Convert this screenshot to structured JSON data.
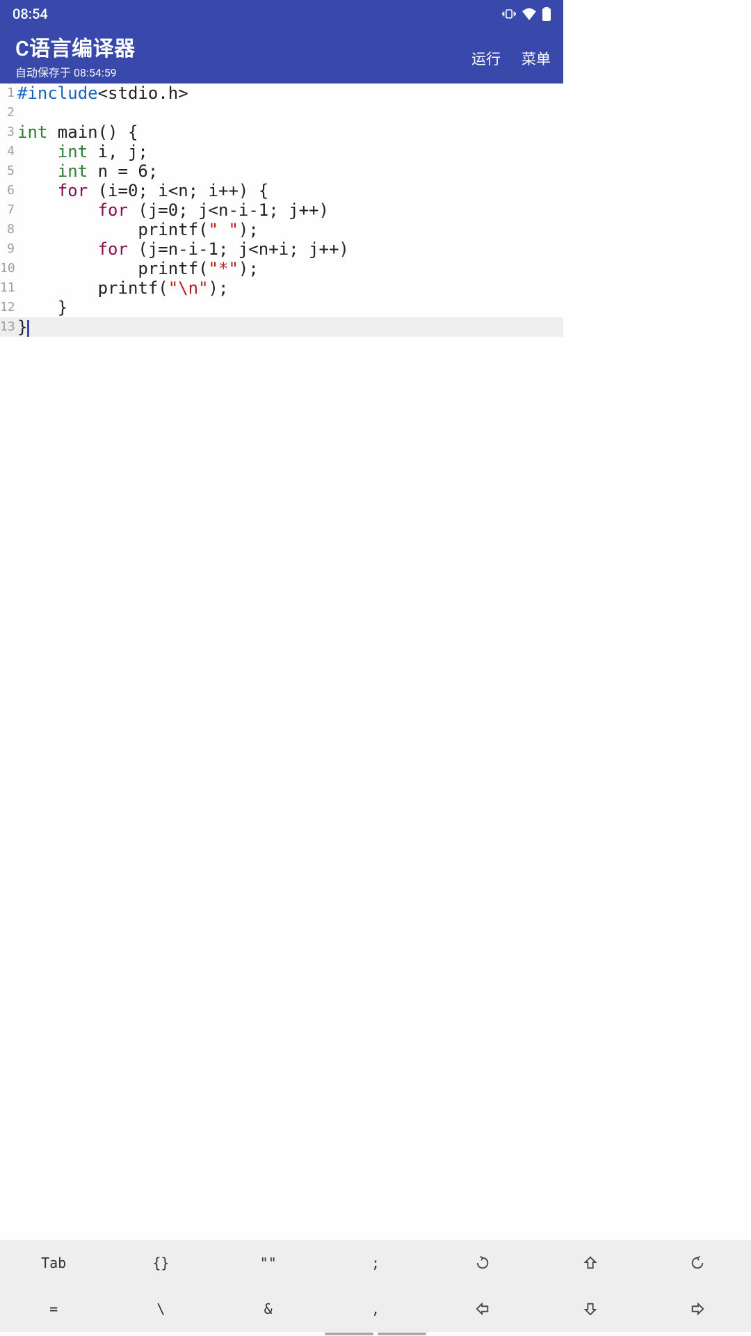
{
  "status": {
    "time": "08:54"
  },
  "app": {
    "title": "C语言编译器",
    "subtitle": "自动保存于 08:54:59",
    "actions": {
      "run": "运行",
      "menu": "菜单"
    }
  },
  "editor": {
    "current_line": 13,
    "lines": [
      {
        "n": "1",
        "tokens": [
          [
            "#include",
            "prep"
          ],
          [
            "<stdio.h>",
            "punct"
          ]
        ]
      },
      {
        "n": "2",
        "tokens": []
      },
      {
        "n": "3",
        "tokens": [
          [
            "int ",
            "kw"
          ],
          [
            "main",
            "fn"
          ],
          [
            "() {",
            "punct"
          ]
        ]
      },
      {
        "n": "4",
        "tokens": [
          [
            "    ",
            "punct"
          ],
          [
            "int ",
            "kw"
          ],
          [
            "i, j;",
            "ident"
          ]
        ]
      },
      {
        "n": "5",
        "tokens": [
          [
            "    ",
            "punct"
          ],
          [
            "int ",
            "kw"
          ],
          [
            "n = ",
            "ident"
          ],
          [
            "6",
            "num"
          ],
          [
            ";",
            "punct"
          ]
        ]
      },
      {
        "n": "6",
        "tokens": [
          [
            "    ",
            "punct"
          ],
          [
            "for ",
            "ctrl"
          ],
          [
            "(i=",
            "ident"
          ],
          [
            "0",
            "num"
          ],
          [
            "; i<n; i++) {",
            "ident"
          ]
        ]
      },
      {
        "n": "7",
        "tokens": [
          [
            "        ",
            "punct"
          ],
          [
            "for ",
            "ctrl"
          ],
          [
            "(j=",
            "ident"
          ],
          [
            "0",
            "num"
          ],
          [
            "; j<n-i-",
            "ident"
          ],
          [
            "1",
            "num"
          ],
          [
            "; j++)",
            "ident"
          ]
        ]
      },
      {
        "n": "8",
        "tokens": [
          [
            "            printf(",
            "fn"
          ],
          [
            "\" \"",
            "str"
          ],
          [
            ");",
            "punct"
          ]
        ]
      },
      {
        "n": "9",
        "tokens": [
          [
            "        ",
            "punct"
          ],
          [
            "for ",
            "ctrl"
          ],
          [
            "(j=n-i-",
            "ident"
          ],
          [
            "1",
            "num"
          ],
          [
            "; j<n+i; j++)",
            "ident"
          ]
        ]
      },
      {
        "n": "10",
        "tokens": [
          [
            "            printf(",
            "fn"
          ],
          [
            "\"*\"",
            "str"
          ],
          [
            ");",
            "punct"
          ]
        ]
      },
      {
        "n": "11",
        "tokens": [
          [
            "        printf(",
            "fn"
          ],
          [
            "\"\\n\"",
            "str"
          ],
          [
            ");",
            "punct"
          ]
        ]
      },
      {
        "n": "12",
        "tokens": [
          [
            "    }",
            "punct"
          ]
        ]
      },
      {
        "n": "13",
        "tokens": [
          [
            "}",
            "punct"
          ]
        ]
      }
    ]
  },
  "toolbar": {
    "row1": [
      "Tab",
      "{}",
      "\"\"",
      ";",
      "undo",
      "shift-up",
      "redo"
    ],
    "row2": [
      "=",
      "\\",
      "&",
      ",",
      "arrow-left",
      "arrow-down",
      "arrow-right"
    ]
  }
}
